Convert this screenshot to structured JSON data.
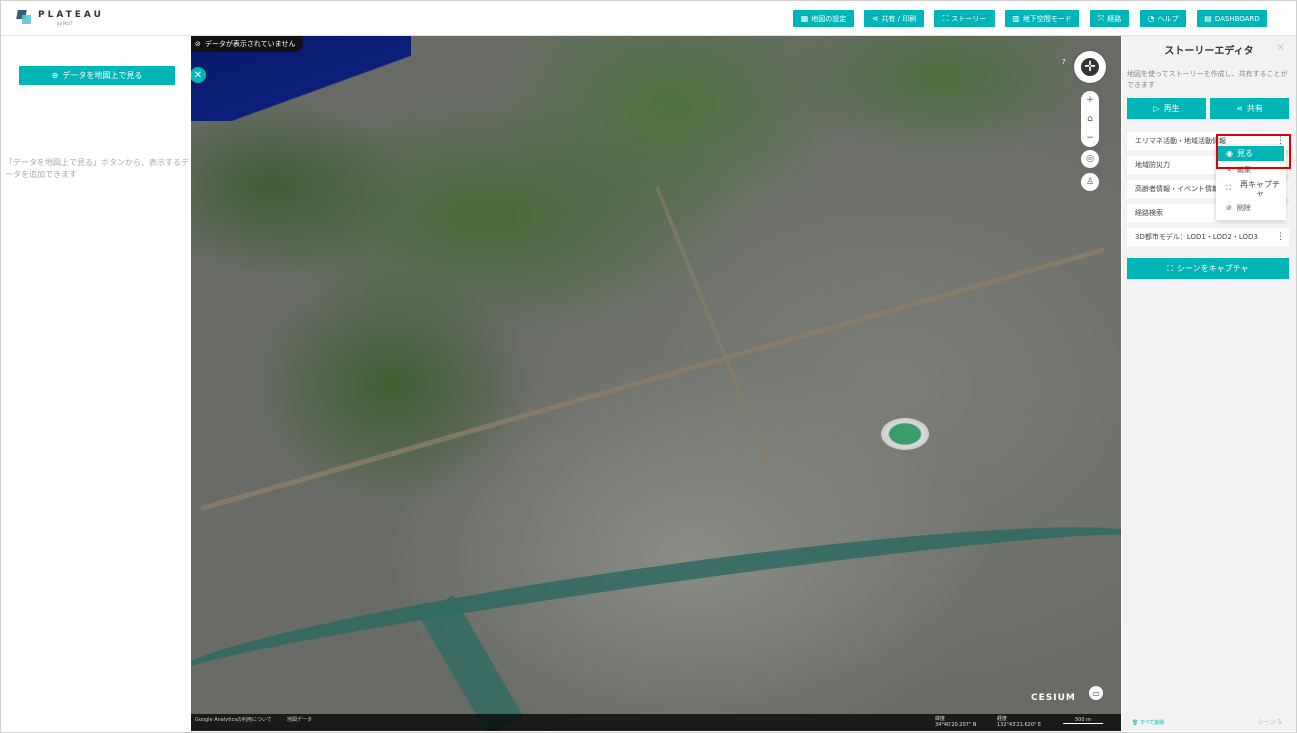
{
  "header": {
    "brand": "PLATEAU",
    "brand_sub": "by MLIT",
    "nav": [
      {
        "label": "地図の設定",
        "icon": "map-settings-icon",
        "glyph": "▦"
      },
      {
        "label": "共有 / 印刷",
        "icon": "share-icon",
        "glyph": "⋖"
      },
      {
        "label": "ストーリー",
        "icon": "story-icon",
        "glyph": "⛶"
      },
      {
        "label": "地下空間モード",
        "icon": "underground-icon",
        "glyph": "▥"
      },
      {
        "label": "経路",
        "icon": "route-icon",
        "glyph": "⤧"
      },
      {
        "label": "ヘルプ",
        "icon": "help-icon",
        "glyph": "◔"
      },
      {
        "label": "DASHBOARD",
        "icon": "dashboard-icon",
        "glyph": "▤"
      }
    ]
  },
  "left_panel": {
    "add_button": "データを地図上で見る",
    "hint": "「データを地図上で見る」ボタンから、表示するデータを追加できます"
  },
  "map": {
    "no_data": "データが表示されていません",
    "attribution_link": "Google Analyticsの利用について",
    "data_link": "地図データ",
    "lat_label": "緯度",
    "lat_value": "34°40′20.207\" N",
    "lon_label": "経度",
    "lon_value": "132°43′21.620\" E",
    "scale_label": "500 m",
    "cesium_logo": "CESIUM",
    "help_mark": "?"
  },
  "story_editor": {
    "title": "ストーリーエディタ",
    "description": "地図を使ってストーリーを作成し、共有することができます",
    "play_label": "再生",
    "share_label": "共有",
    "scenes": [
      "エリマネ活動・地域活動情報",
      "地域防災力",
      "高齢者情報・イベント情報",
      "経路検索",
      "3D都市モデル：LOD1・LOD2・LOD3"
    ],
    "capture_label": "シーンをキャプチャ",
    "footer_left": "すべて削除",
    "footer_right": "シーン 5"
  },
  "context_menu": {
    "view": "見る",
    "edit": "編集",
    "recapture": "再キャプチャ",
    "delete": "削除"
  },
  "colors": {
    "accent": "#00b5b5",
    "highlight": "#e00000"
  }
}
